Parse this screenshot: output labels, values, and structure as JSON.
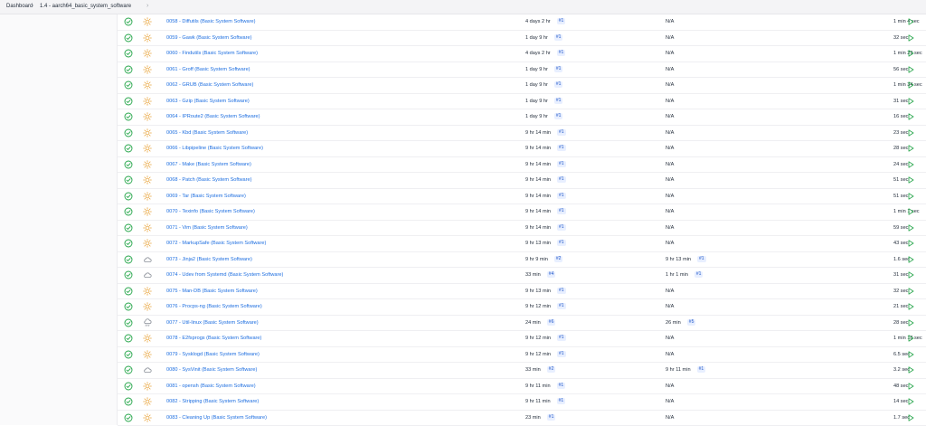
{
  "breadcrumb": {
    "items": [
      "Dashboard",
      "1.4 - aarch64_basic_system_software"
    ]
  },
  "colors": {
    "link": "#1d6ee0",
    "success": "#22a447",
    "weather_sun": "#e8a33a",
    "weather_cloud": "#8a8f98",
    "run": "#22a447"
  },
  "columns": [
    "status",
    "weather",
    "name",
    "last_success",
    "last_failure",
    "last_duration",
    "run"
  ],
  "jobs": [
    {
      "name": "0058 - Diffutils (Basic System Software)",
      "weather": "sun",
      "last_success": "4 days 2 hr",
      "success_build": "#1",
      "last_failure": "N/A",
      "failure_build": "",
      "duration": "1 min 4 sec"
    },
    {
      "name": "0059 - Gawk (Basic System Software)",
      "weather": "sun",
      "last_success": "1 day 9 hr",
      "success_build": "#1",
      "last_failure": "N/A",
      "failure_build": "",
      "duration": "32 sec"
    },
    {
      "name": "0060 - Findutils (Basic System Software)",
      "weather": "sun",
      "last_success": "4 days 2 hr",
      "success_build": "#1",
      "last_failure": "N/A",
      "failure_build": "",
      "duration": "1 min 29 sec"
    },
    {
      "name": "0061 - Groff (Basic System Software)",
      "weather": "sun",
      "last_success": "1 day 9 hr",
      "success_build": "#1",
      "last_failure": "N/A",
      "failure_build": "",
      "duration": "56 sec"
    },
    {
      "name": "0062 - GRUB (Basic System Software)",
      "weather": "sun",
      "last_success": "1 day 9 hr",
      "success_build": "#1",
      "last_failure": "N/A",
      "failure_build": "",
      "duration": "1 min 34 sec"
    },
    {
      "name": "0063 - Gzip (Basic System Software)",
      "weather": "sun",
      "last_success": "1 day 9 hr",
      "success_build": "#1",
      "last_failure": "N/A",
      "failure_build": "",
      "duration": "31 sec"
    },
    {
      "name": "0064 - IPRoute2 (Basic System Software)",
      "weather": "sun",
      "last_success": "1 day 9 hr",
      "success_build": "#1",
      "last_failure": "N/A",
      "failure_build": "",
      "duration": "16 sec"
    },
    {
      "name": "0065 - Kbd (Basic System Software)",
      "weather": "sun",
      "last_success": "9 hr 14 min",
      "success_build": "#1",
      "last_failure": "N/A",
      "failure_build": "",
      "duration": "23 sec"
    },
    {
      "name": "0066 - Libpipeline (Basic System Software)",
      "weather": "sun",
      "last_success": "9 hr 14 min",
      "success_build": "#1",
      "last_failure": "N/A",
      "failure_build": "",
      "duration": "28 sec"
    },
    {
      "name": "0067 - Make (Basic System Software)",
      "weather": "sun",
      "last_success": "9 hr 14 min",
      "success_build": "#1",
      "last_failure": "N/A",
      "failure_build": "",
      "duration": "24 sec"
    },
    {
      "name": "0068 - Patch (Basic System Software)",
      "weather": "sun",
      "last_success": "9 hr 14 min",
      "success_build": "#1",
      "last_failure": "N/A",
      "failure_build": "",
      "duration": "51 sec"
    },
    {
      "name": "0069 - Tar (Basic System Software)",
      "weather": "sun",
      "last_success": "9 hr 14 min",
      "success_build": "#1",
      "last_failure": "N/A",
      "failure_build": "",
      "duration": "51 sec"
    },
    {
      "name": "0070 - Texinfo (Basic System Software)",
      "weather": "sun",
      "last_success": "9 hr 14 min",
      "success_build": "#1",
      "last_failure": "N/A",
      "failure_build": "",
      "duration": "1 min 1 sec"
    },
    {
      "name": "0071 - Vim (Basic System Software)",
      "weather": "sun",
      "last_success": "9 hr 14 min",
      "success_build": "#1",
      "last_failure": "N/A",
      "failure_build": "",
      "duration": "59 sec"
    },
    {
      "name": "0072 - MarkupSafe (Basic System Software)",
      "weather": "sun",
      "last_success": "9 hr 13 min",
      "success_build": "#1",
      "last_failure": "N/A",
      "failure_build": "",
      "duration": "43 sec"
    },
    {
      "name": "0073 - Jinja2 (Basic System Software)",
      "weather": "cloud",
      "last_success": "9 hr 9 min",
      "success_build": "#2",
      "last_failure": "9 hr 13 min",
      "failure_build": "#1",
      "duration": "1.6 sec"
    },
    {
      "name": "0074 - Udev from Systemd (Basic System Software)",
      "weather": "cloud",
      "last_success": "33 min",
      "success_build": "#4",
      "last_failure": "1 hr 1 min",
      "failure_build": "#1",
      "duration": "31 sec"
    },
    {
      "name": "0075 - Man-DB (Basic System Software)",
      "weather": "sun",
      "last_success": "9 hr 13 min",
      "success_build": "#1",
      "last_failure": "N/A",
      "failure_build": "",
      "duration": "32 sec"
    },
    {
      "name": "0076 - Procps-ng (Basic System Software)",
      "weather": "sun",
      "last_success": "9 hr 12 min",
      "success_build": "#1",
      "last_failure": "N/A",
      "failure_build": "",
      "duration": "21 sec"
    },
    {
      "name": "0077 - Util-linux (Basic System Software)",
      "weather": "rain",
      "last_success": "24 min",
      "success_build": "#6",
      "last_failure": "26 min",
      "failure_build": "#5",
      "duration": "28 sec"
    },
    {
      "name": "0078 - E2fsprogs (Basic System Software)",
      "weather": "sun",
      "last_success": "9 hr 12 min",
      "success_build": "#1",
      "last_failure": "N/A",
      "failure_build": "",
      "duration": "1 min 18 sec"
    },
    {
      "name": "0079 - Sysklogd (Basic System Software)",
      "weather": "sun",
      "last_success": "9 hr 12 min",
      "success_build": "#1",
      "last_failure": "N/A",
      "failure_build": "",
      "duration": "6.5 sec"
    },
    {
      "name": "0080 - SysVinit (Basic System Software)",
      "weather": "cloud",
      "last_success": "33 min",
      "success_build": "#2",
      "last_failure": "9 hr 11 min",
      "failure_build": "#1",
      "duration": "3.2 sec"
    },
    {
      "name": "0081 - opensh (Basic System Software)",
      "weather": "sun",
      "last_success": "9 hr 11 min",
      "success_build": "#1",
      "last_failure": "N/A",
      "failure_build": "",
      "duration": "48 sec"
    },
    {
      "name": "0082 - Stripping (Basic System Software)",
      "weather": "sun",
      "last_success": "9 hr 11 min",
      "success_build": "#1",
      "last_failure": "N/A",
      "failure_build": "",
      "duration": "14 sec"
    },
    {
      "name": "0083 - Cleaning Up (Basic System Software)",
      "weather": "sun",
      "last_success": "23 min",
      "success_build": "#1",
      "last_failure": "N/A",
      "failure_build": "",
      "duration": "1.7 sec"
    }
  ]
}
